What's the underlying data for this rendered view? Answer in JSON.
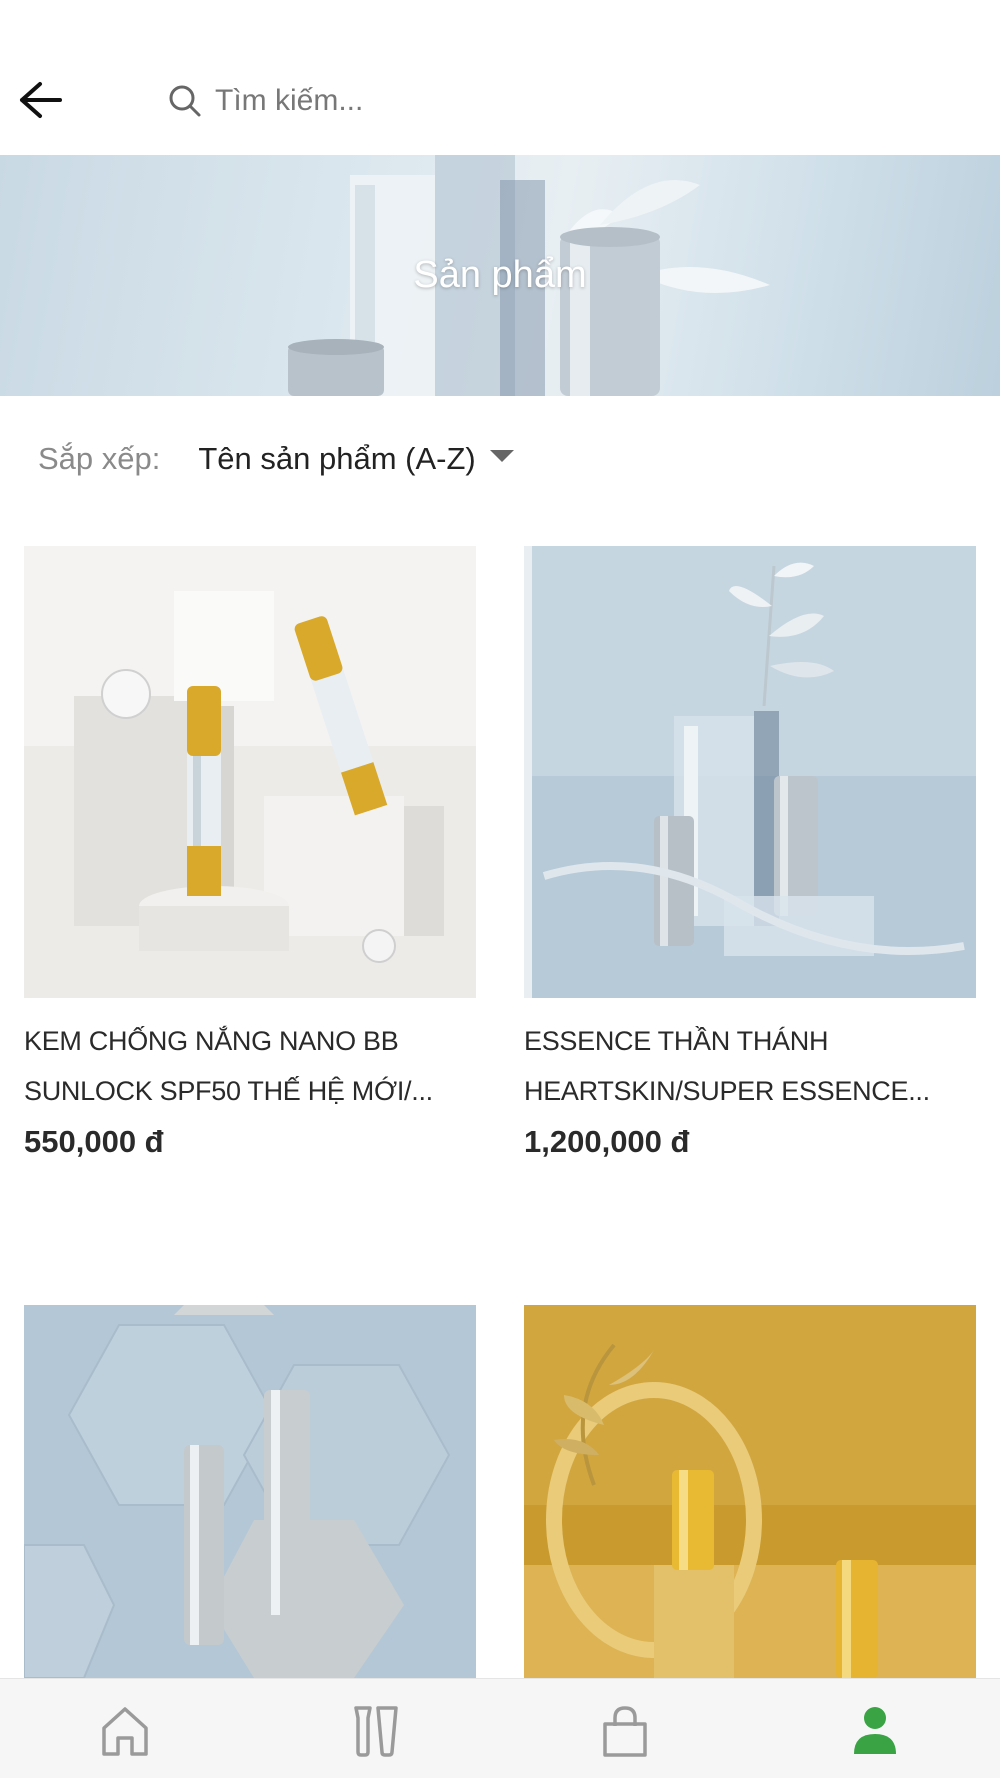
{
  "search": {
    "placeholder": "Tìm kiếm..."
  },
  "banner": {
    "title": "Sản phẩm"
  },
  "sort": {
    "label": "Sắp xếp:",
    "selected": "Tên sản phẩm (A-Z)"
  },
  "products": [
    {
      "name": "KEM CHỐNG NẮNG NANO BB SUNLOCK SPF50 THẾ HỆ MỚI/...",
      "price": "550,000 đ"
    },
    {
      "name": "ESSENCE THẦN THÁNH HEARTSKIN/SUPER ESSENCE...",
      "price": "1,200,000 đ"
    },
    {
      "name": "",
      "price": ""
    },
    {
      "name": "",
      "price": ""
    }
  ],
  "nav": {
    "items": [
      "home-icon",
      "products-icon",
      "bag-icon",
      "user-icon"
    ],
    "active_color": "#3aa344",
    "inactive_color": "#9a9a9a"
  }
}
